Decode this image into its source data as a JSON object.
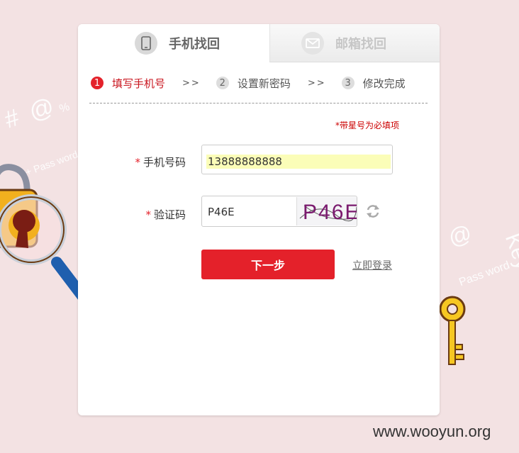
{
  "tabs": {
    "phone": {
      "label": "手机找回",
      "icon": "phone-icon"
    },
    "email": {
      "label": "邮箱找回",
      "icon": "mail-icon"
    }
  },
  "steps": [
    {
      "num": "1",
      "label": "填写手机号",
      "active": true
    },
    {
      "num": "2",
      "label": "设置新密码",
      "active": false
    },
    {
      "num": "3",
      "label": "修改完成",
      "active": false
    }
  ],
  "step_separator": ">>",
  "required_note": "*带星号为必填项",
  "form": {
    "required_star": "*",
    "phone": {
      "label": "手机号码",
      "value": "13888888888"
    },
    "captcha": {
      "label": "验证码",
      "value": "P46E",
      "image_text": "P46E"
    }
  },
  "actions": {
    "next_label": "下一步",
    "login_label": "立即登录"
  },
  "decorations": {
    "symbols_left": "# @",
    "percent_left": "%",
    "pass_left": "+ Pass word",
    "symbols_right": "* @",
    "key_right": "Key",
    "pass_right": "Pass word"
  },
  "watermark": "www.wooyun.org",
  "colors": {
    "background": "#f3e2e3",
    "accent_red": "#e4212a",
    "input_autofill": "#fbfdb8"
  }
}
